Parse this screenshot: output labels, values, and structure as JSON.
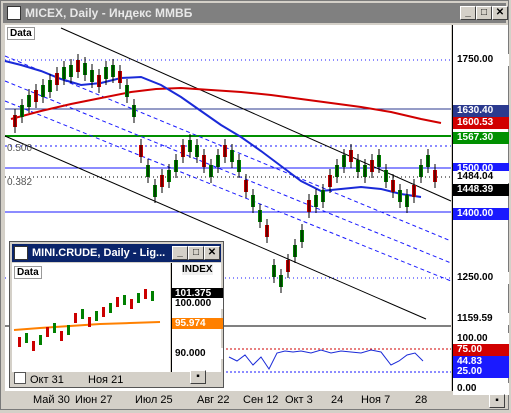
{
  "main_window": {
    "title": "MICEX, Daily - Индекс ММВБ",
    "data_tag": "Data",
    "fib_levels": [
      "0.500",
      "0.382"
    ],
    "price_tags": [
      {
        "label": "1750.00",
        "bg": "#ffffff",
        "fg": "#000000"
      },
      {
        "label": "1630.40",
        "bg": "#2b3a8f",
        "fg": "#ffffff"
      },
      {
        "label": "1600.53",
        "bg": "#d10000",
        "fg": "#ffffff"
      },
      {
        "label": "1567.30",
        "bg": "#009000",
        "fg": "#ffffff"
      },
      {
        "label": "1500.00",
        "bg": "#1a1aff",
        "fg": "#ffffff"
      },
      {
        "label": "1484.04",
        "bg": "#ffffff",
        "fg": "#000000"
      },
      {
        "label": "1448.39",
        "bg": "#000000",
        "fg": "#ffffff"
      },
      {
        "label": "1400.00",
        "bg": "#1a1aff",
        "fg": "#ffffff"
      },
      {
        "label": "1250.00",
        "bg": "#ffffff",
        "fg": "#000000"
      },
      {
        "label": "1159.59",
        "bg": "#ffffff",
        "fg": "#000000"
      }
    ],
    "indicator_tags": [
      {
        "label": "100.00",
        "bg": "#ffffff",
        "fg": "#000000"
      },
      {
        "label": "75.00",
        "bg": "#d10000",
        "fg": "#ffffff"
      },
      {
        "label": "44.83",
        "bg": "#1a1aff",
        "fg": "#ffffff"
      },
      {
        "label": "25.00",
        "bg": "#1a1aff",
        "fg": "#ffffff"
      },
      {
        "label": "0.00",
        "bg": "#ffffff",
        "fg": "#000000"
      }
    ],
    "x_labels": [
      "Май 30",
      "Июн 27",
      "Июл 25",
      "Авг 22",
      "Сен 12",
      "Окт 3",
      "24",
      "Ноя 7",
      "28"
    ]
  },
  "sub_window": {
    "title": "MINI.CRUDE, Daily - Lig...",
    "data_tag": "Data",
    "index_tag": "INDEX",
    "price_tags": [
      {
        "label": "101.375",
        "bg": "#000000",
        "fg": "#ffffff"
      },
      {
        "label": "100.000",
        "bg": "#ffffff",
        "fg": "#000000"
      },
      {
        "label": "95.974",
        "bg": "#ff8000",
        "fg": "#ffffff"
      },
      {
        "label": "90.000",
        "bg": "#ffffff",
        "fg": "#000000"
      }
    ],
    "x_labels": [
      "Окт 31",
      "Ноя 21"
    ]
  },
  "colors": {
    "ma_red": "#d10000",
    "ma_blue": "#1a2ad8",
    "support_green": "#009000",
    "candle_green": "#008000",
    "candle_red": "#cc0000",
    "ma_orange": "#ff8000"
  }
}
